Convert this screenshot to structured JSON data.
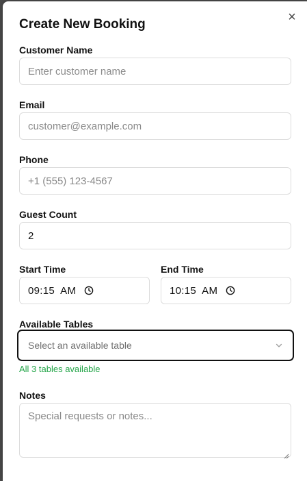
{
  "dialog": {
    "title": "Create New Booking",
    "close_glyph": "×"
  },
  "fields": {
    "customer_name": {
      "label": "Customer Name",
      "value": "",
      "placeholder": "Enter customer name"
    },
    "email": {
      "label": "Email",
      "value": "",
      "placeholder": "customer@example.com"
    },
    "phone": {
      "label": "Phone",
      "value": "",
      "placeholder": "+1 (555) 123-4567"
    },
    "guest_count": {
      "label": "Guest Count",
      "value": "2"
    },
    "start_time": {
      "label": "Start Time",
      "value": "09:15  AM"
    },
    "end_time": {
      "label": "End Time",
      "value": "10:15  AM"
    },
    "available_tables": {
      "label": "Available Tables",
      "placeholder": "Select an available table",
      "hint": "All 3 tables available"
    },
    "notes": {
      "label": "Notes",
      "value": "",
      "placeholder": "Special requests or notes..."
    }
  },
  "icons": {
    "close": "close-icon",
    "clock": "clock-icon",
    "chevron": "chevron-down-icon"
  },
  "colors": {
    "hint": "#22a447",
    "focus_border": "#111111"
  }
}
